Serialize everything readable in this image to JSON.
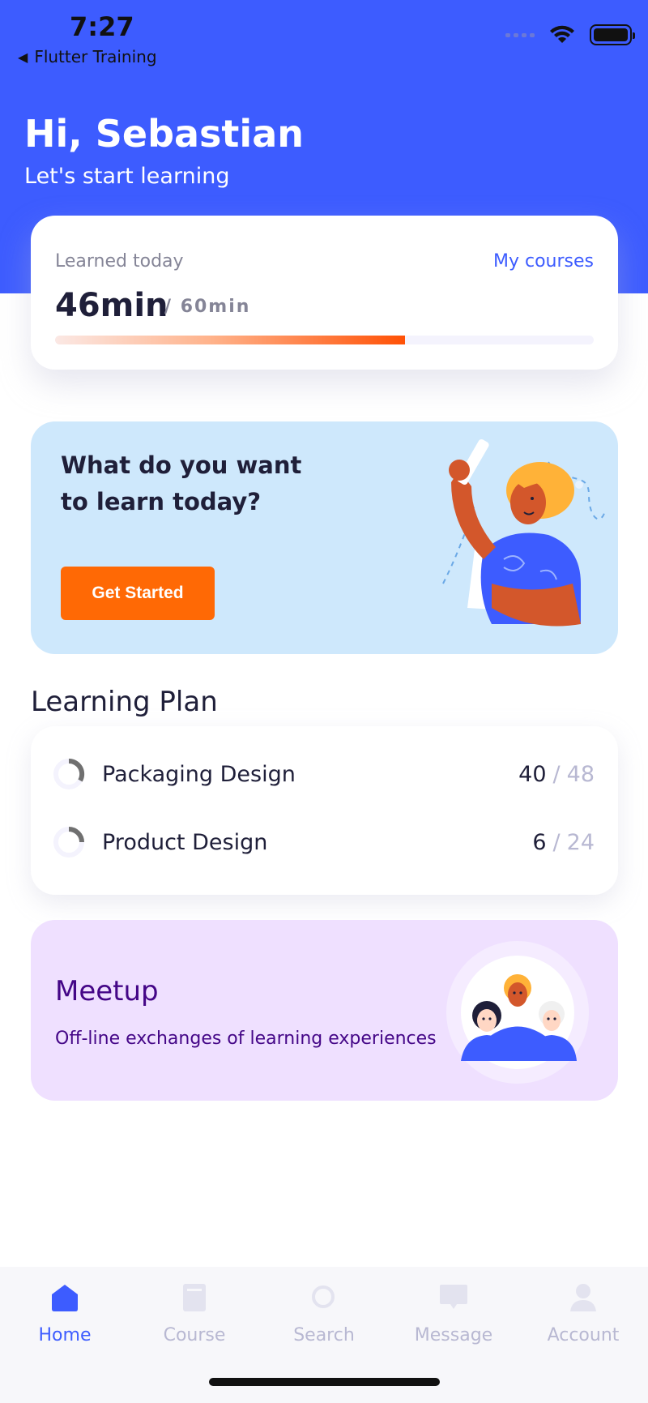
{
  "status_bar": {
    "time": "7:27",
    "back_label": "Flutter Training"
  },
  "header": {
    "greeting": "Hi, Sebastian",
    "subtitle": "Let's start learning"
  },
  "progress_card": {
    "label": "Learned today",
    "link": "My courses",
    "learned": "46min",
    "goal": "/ 60min",
    "progress_fraction": 0.65
  },
  "hero": {
    "title": "What do you want to learn today?",
    "button": "Get Started"
  },
  "learning_plan": {
    "title": "Learning Plan",
    "items": [
      {
        "name": "Packaging Design",
        "done": "40",
        "total": "48",
        "sep": "/"
      },
      {
        "name": "Product Design",
        "done": "6",
        "total": "24",
        "sep": "/"
      }
    ]
  },
  "meetup": {
    "title": "Meetup",
    "description": "Off-line exchanges of learning experiences"
  },
  "tabbar": {
    "items": [
      {
        "label": "Home",
        "icon": "home-icon",
        "active": true
      },
      {
        "label": "Course",
        "icon": "book-icon",
        "active": false
      },
      {
        "label": "Search",
        "icon": "search-icon",
        "active": false
      },
      {
        "label": "Message",
        "icon": "message-icon",
        "active": false
      },
      {
        "label": "Account",
        "icon": "account-icon",
        "active": false
      }
    ]
  },
  "colors": {
    "primary": "#3d5cff",
    "accent": "#ff6905",
    "hero_bg": "#cee8fc",
    "meetup_bg": "#efe0ff",
    "meetup_text": "#440687",
    "muted": "#b8b8d2"
  }
}
